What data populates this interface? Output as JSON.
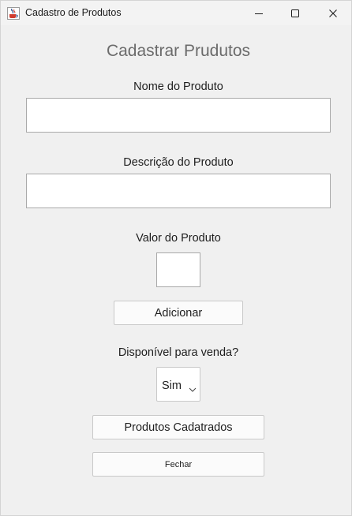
{
  "window": {
    "title": "Cadastro de Produtos",
    "icons": {
      "app": "java-cup-icon",
      "minimize": "minimize-icon",
      "maximize": "maximize-icon",
      "close": "close-icon"
    }
  },
  "form": {
    "heading": "Cadastrar Prudutos",
    "name_label": "Nome do Produto",
    "name_value": "",
    "description_label": "Descrição do Produto",
    "description_value": "",
    "price_label": "Valor do Produto",
    "price_value": "",
    "add_button": "Adicionar",
    "available_label": "Disponível para venda?",
    "available_selected": "Sim",
    "products_button": "Produtos Cadatrados",
    "close_button": "Fechar"
  }
}
